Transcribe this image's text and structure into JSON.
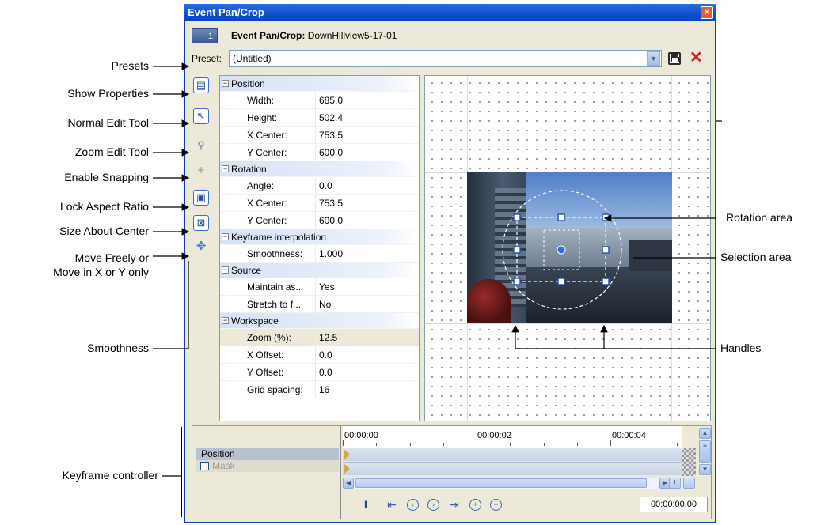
{
  "window": {
    "title": "Event Pan/Crop",
    "media_number": "1",
    "event_label": "Event Pan/Crop:",
    "event_name": "DownHillview5-17-01"
  },
  "preset": {
    "label": "Preset:",
    "value": "(Untitled)"
  },
  "properties": {
    "groups": [
      {
        "name": "Position",
        "rows": [
          {
            "name": "Width:",
            "value": "685.0"
          },
          {
            "name": "Height:",
            "value": "502.4"
          },
          {
            "name": "X Center:",
            "value": "753.5"
          },
          {
            "name": "Y Center:",
            "value": "600.0"
          }
        ]
      },
      {
        "name": "Rotation",
        "rows": [
          {
            "name": "Angle:",
            "value": "0.0"
          },
          {
            "name": "X Center:",
            "value": "753.5"
          },
          {
            "name": "Y Center:",
            "value": "600.0"
          }
        ]
      },
      {
        "name": "Keyframe interpolation",
        "rows": [
          {
            "name": "Smoothness:",
            "value": "1.000"
          }
        ]
      },
      {
        "name": "Source",
        "rows": [
          {
            "name": "Maintain as...",
            "value": "Yes"
          },
          {
            "name": "Stretch to f...",
            "value": "No"
          }
        ]
      },
      {
        "name": "Workspace",
        "rows": [
          {
            "name": "Zoom (%):",
            "value": "12.5"
          },
          {
            "name": "X Offset:",
            "value": "0.0"
          },
          {
            "name": "Y Offset:",
            "value": "0.0"
          },
          {
            "name": "Grid spacing:",
            "value": "16"
          }
        ]
      }
    ]
  },
  "keyframes": {
    "tracks": [
      "Position",
      "Mask"
    ],
    "ruler": [
      "00:00:00",
      "00:00:02",
      "00:00:04"
    ],
    "timecode": "00:00:00.00"
  },
  "callouts": {
    "left": [
      "Presets",
      "Show Properties",
      "Normal Edit Tool",
      "Zoom Edit Tool",
      "Enable Snapping",
      "Lock Aspect Ratio",
      "Size About Center",
      "Move Freely or",
      "Move in X or Y only",
      "Smoothness",
      "Keyframe controller"
    ],
    "right": [
      "Rotation area",
      "Selection area",
      "Handles"
    ]
  },
  "colors": {
    "titlebar": "#0a50cf",
    "window_bg": "#ece9d8",
    "group_header": "#d6e2f6",
    "delete": "#c8201a"
  }
}
